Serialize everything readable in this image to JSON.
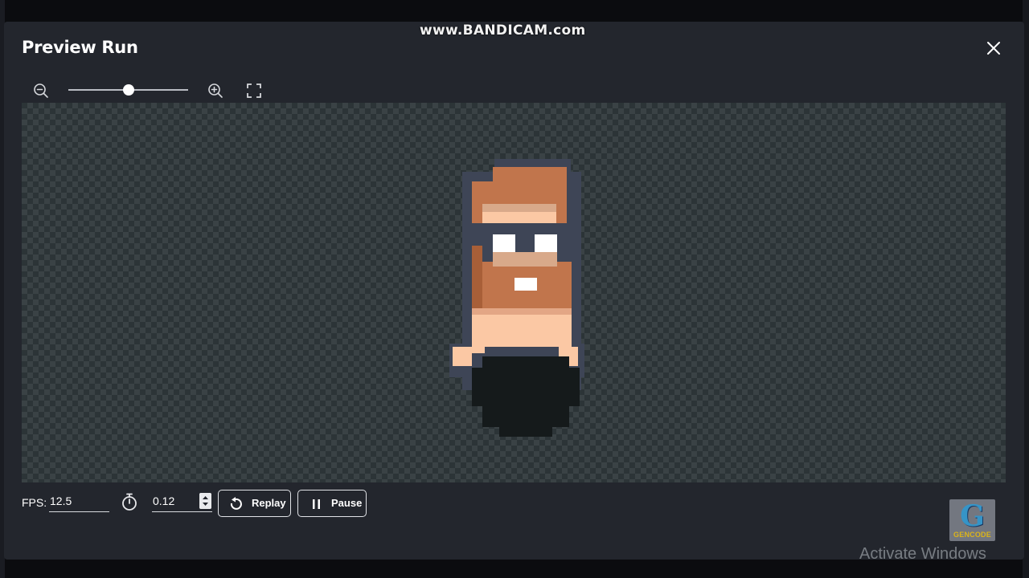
{
  "overlay": {
    "watermark": "www.BANDICAM.com",
    "activate_windows": "Activate Windows",
    "logo_text": "GENCODE",
    "logo_letter": "G"
  },
  "dialog": {
    "title": "Preview Run"
  },
  "toolbar": {
    "zoom_level": 0.5
  },
  "controls": {
    "fps_label": "FPS:",
    "fps_value": "12.5",
    "frame_duration": "0.12",
    "replay_label": "Replay",
    "pause_label": "Pause"
  },
  "colors": {
    "panel": "#23262d",
    "canvas_light": "#3a4245",
    "canvas_dark": "#2c3437",
    "sprite_hair": "#c1754c",
    "sprite_skin": "#fbc8a4",
    "sprite_outline": "#3e4556",
    "sprite_shadow": "#151a1b"
  },
  "icons": [
    "close-icon",
    "zoom-out-icon",
    "zoom-in-icon",
    "fullscreen-icon",
    "timer-icon",
    "replay-icon",
    "pause-icon",
    "stepper-icon"
  ]
}
